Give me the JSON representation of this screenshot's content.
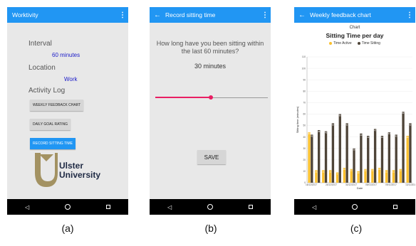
{
  "panel_a": {
    "app_title": "Worktivity",
    "menu_icon": "⋮",
    "interval_label": "Interval",
    "interval_value": "60 minutes",
    "location_label": "Location",
    "location_value": "Work",
    "activity_log_label": "Activity Log",
    "btn_weekly": "WEEKLY FEEDBACK CHART",
    "btn_daily": "DAILY GOAL RATING",
    "btn_record": "RECORD SITTING TIME",
    "logo_line1": "Ulster",
    "logo_line2": "University"
  },
  "panel_b": {
    "title": "Record sitting time",
    "back_icon": "←",
    "menu_icon": "⋮",
    "question": "How long have you been sitting within the last 60 minutes?",
    "minutes_value": "30 minutes",
    "slider_fraction": 0.5,
    "save_label": "SAVE"
  },
  "panel_c": {
    "title": "Weekly feedback chart",
    "back_icon": "←",
    "menu_icon": "⋮",
    "header": "Chart"
  },
  "nav": {
    "back": "◁",
    "home": "○",
    "recent": "□"
  },
  "captions": {
    "a": "(a)",
    "b": "(b)",
    "c": "(c)"
  },
  "colors": {
    "app_bar": "#2196f3",
    "accent": "#e91e63",
    "active_bar": "#fbc02d",
    "sitting_bar": "#4e4438"
  },
  "chart_data": {
    "type": "bar",
    "title": "Sitting Time per day",
    "legend": [
      {
        "name": "Time Active",
        "color": "#fbc02d"
      },
      {
        "name": "Time Sitting",
        "color": "#4e4438"
      }
    ],
    "legend_position": "top",
    "xlabel": "Date",
    "ylabel": "Sitting time (minutes)",
    "ylim": [
      0,
      110
    ],
    "yticks": [
      0,
      10,
      20,
      30,
      40,
      50,
      60,
      70,
      80,
      90,
      100,
      110
    ],
    "xtick_labels": [
      "16/12/2017",
      "24/12/2017",
      "30/12/2017",
      "05/01/2017",
      "09/11/2017",
      "13/11/2017"
    ],
    "sitting_values": [
      42,
      46,
      45,
      52,
      60,
      52,
      30,
      43,
      41,
      47,
      41,
      44,
      42,
      62,
      52
    ],
    "active_values": [
      44,
      11,
      11,
      11,
      9,
      13,
      12,
      10,
      12,
      12,
      13,
      11,
      11,
      12,
      41
    ]
  }
}
